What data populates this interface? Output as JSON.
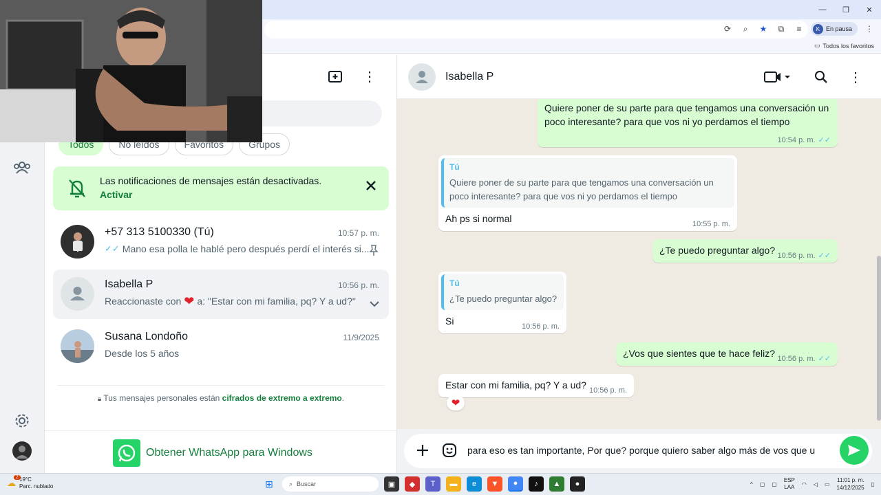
{
  "browser": {
    "profile_initial": "K",
    "profile_status": "En pausa",
    "bookmarks_all": "Todos los favoritos"
  },
  "sidebar": {
    "filters": [
      {
        "label": "Todos",
        "active": true
      },
      {
        "label": "No leídos",
        "active": false
      },
      {
        "label": "Favoritos",
        "active": false
      },
      {
        "label": "Grupos",
        "active": false
      }
    ],
    "notification": {
      "title": "Las notificaciones de mensajes están desactivadas.",
      "action": "Activar"
    },
    "chats": [
      {
        "name": "+57 313 5100330 (Tú)",
        "time": "10:57 p. m.",
        "preview": "Mano esa polla le hablé pero después perdí el interés si...",
        "pinned": true
      },
      {
        "name": "Isabella P",
        "time": "10:56 p. m.",
        "preview_before": "Reaccionaste con",
        "preview_after": "a: \"Estar con mi familia, pq? Y a ud?\"",
        "selected": true
      },
      {
        "name": "Susana Londoño",
        "time": "11/9/2025",
        "preview": "Desde los 5 años"
      }
    ],
    "encryption_prefix": "Tus mensajes personales están",
    "encryption_link": "cifrados de extremo a extremo",
    "encryption_suffix": ".",
    "get_app": "Obtener WhatsApp para Windows"
  },
  "conversation": {
    "contact_name": "Isabella P",
    "messages": [
      {
        "dir": "out",
        "text": "Quiere poner de su parte para que tengamos una conversación un poco interesante? para que vos ni yo perdamos el tiempo",
        "time": "10:54 p. m."
      },
      {
        "dir": "in",
        "quote_author": "Tú",
        "quote_text": "Quiere poner de su parte para que tengamos una conversación un poco interesante? para que vos ni yo perdamos el tiempo",
        "text": "Ah ps si normal",
        "time": "10:55 p. m."
      },
      {
        "dir": "out",
        "text": "¿Te puedo preguntar algo?",
        "time": "10:56 p. m."
      },
      {
        "dir": "in",
        "quote_author": "Tú",
        "quote_text": "¿Te puedo preguntar algo?",
        "text": "Si",
        "time": "10:56 p. m."
      },
      {
        "dir": "out",
        "text": "¿Vos que sientes que te hace feliz?",
        "time": "10:56 p. m."
      },
      {
        "dir": "in",
        "text": "Estar con mi familia, pq? Y a ud?",
        "time": "10:56 p. m.",
        "reaction": "heart"
      }
    ],
    "composer_value": "para eso es tan importante, Por que? porque quiero saber algo más de vos que u"
  },
  "taskbar": {
    "temperature": "19°C",
    "weather": "Parc. nublado",
    "weather_badge": "2",
    "search_placeholder": "Buscar",
    "lang_1": "ESP",
    "lang_2": "LAA",
    "time": "11:01 p. m.",
    "date": "14/12/2025"
  },
  "colors": {
    "accent": "#25d366",
    "accent_text": "#15803d",
    "outgoing_bubble": "#d9fdd3",
    "chat_background": "#efeae2",
    "read_ticks": "#53bdeb"
  }
}
